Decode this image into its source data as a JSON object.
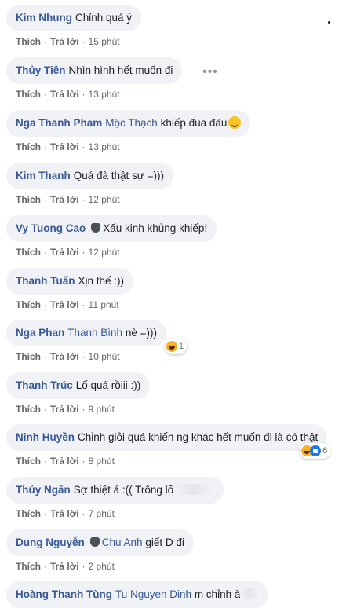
{
  "actions": {
    "like": "Thích",
    "reply": "Trả lời"
  },
  "comments": [
    {
      "author": "Kim Nhung",
      "text": "Chỉnh quá ý",
      "time": "15 phút"
    },
    {
      "author": "Thủy Tiên",
      "text": "Nhìn hình hết muốn đi",
      "time": "13 phút"
    },
    {
      "author": "Nga Thanh Pham",
      "mention": "Mộc Thạch",
      "text": "khiếp đùa đâu",
      "time": "13 phút"
    },
    {
      "author": "Kim Thanh",
      "text": "Quá đà thật sự =)))",
      "time": "12 phút"
    },
    {
      "author": "Vy Tuong Cao",
      "text": "Xấu kinh khủng khiếp!",
      "time": "12 phút"
    },
    {
      "author": "Thanh Tuấn",
      "text": "Xịn thế :))",
      "time": "11 phút"
    },
    {
      "author": "Nga Phan",
      "mention": "Thanh Bình",
      "text": "nè =)))",
      "time": "10 phút",
      "reaction_count": "1"
    },
    {
      "author": "Thanh Trúc",
      "text": "Lố quá rồiii :))",
      "time": "9 phút"
    },
    {
      "author": "Ninh Huyền",
      "text": "Chỉnh giỏi quá khiến ng khác hết muốn đi là có thật",
      "time": "8 phút",
      "reaction_count": "6"
    },
    {
      "author": "Thủy Ngân",
      "text": "Sợ thiệt á :(( Trông lố",
      "time": "7 phút"
    },
    {
      "author": "Dung Nguyễn",
      "mention": "Chu Anh",
      "text": "giết D đi",
      "time": "2 phút"
    },
    {
      "author": "Hoàng Thanh Tùng",
      "mention": "Tu Nguyen Dinh",
      "text": "m chỉnh à"
    }
  ]
}
